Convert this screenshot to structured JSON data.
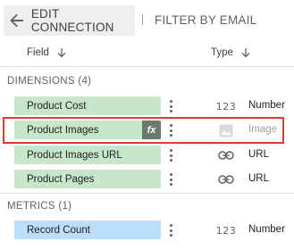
{
  "topbar": {
    "back_label": "EDIT CONNECTION",
    "filter_label": "FILTER BY EMAIL"
  },
  "columns": {
    "field": "Field",
    "type": "Type"
  },
  "dimensions": {
    "label": "DIMENSIONS (4)",
    "items": [
      {
        "name": "Product Cost",
        "type_icon": "number-icon",
        "type_glyph": "123",
        "type": "Number"
      },
      {
        "name": "Product Images",
        "type_icon": "image-icon",
        "type": "Image",
        "badge": "fx"
      },
      {
        "name": "Product Images URL",
        "type_icon": "link-icon",
        "type": "URL"
      },
      {
        "name": "Product Pages",
        "type_icon": "link-icon",
        "type": "URL"
      }
    ]
  },
  "metrics": {
    "label": "METRICS (1)",
    "items": [
      {
        "name": "Record Count",
        "type_icon": "number-icon",
        "type_glyph": "123",
        "type": "Number"
      }
    ]
  },
  "colors": {
    "dimension_chip": "#c8e6c9",
    "metric_chip": "#bbdefb",
    "highlight_border": "#e53935"
  }
}
